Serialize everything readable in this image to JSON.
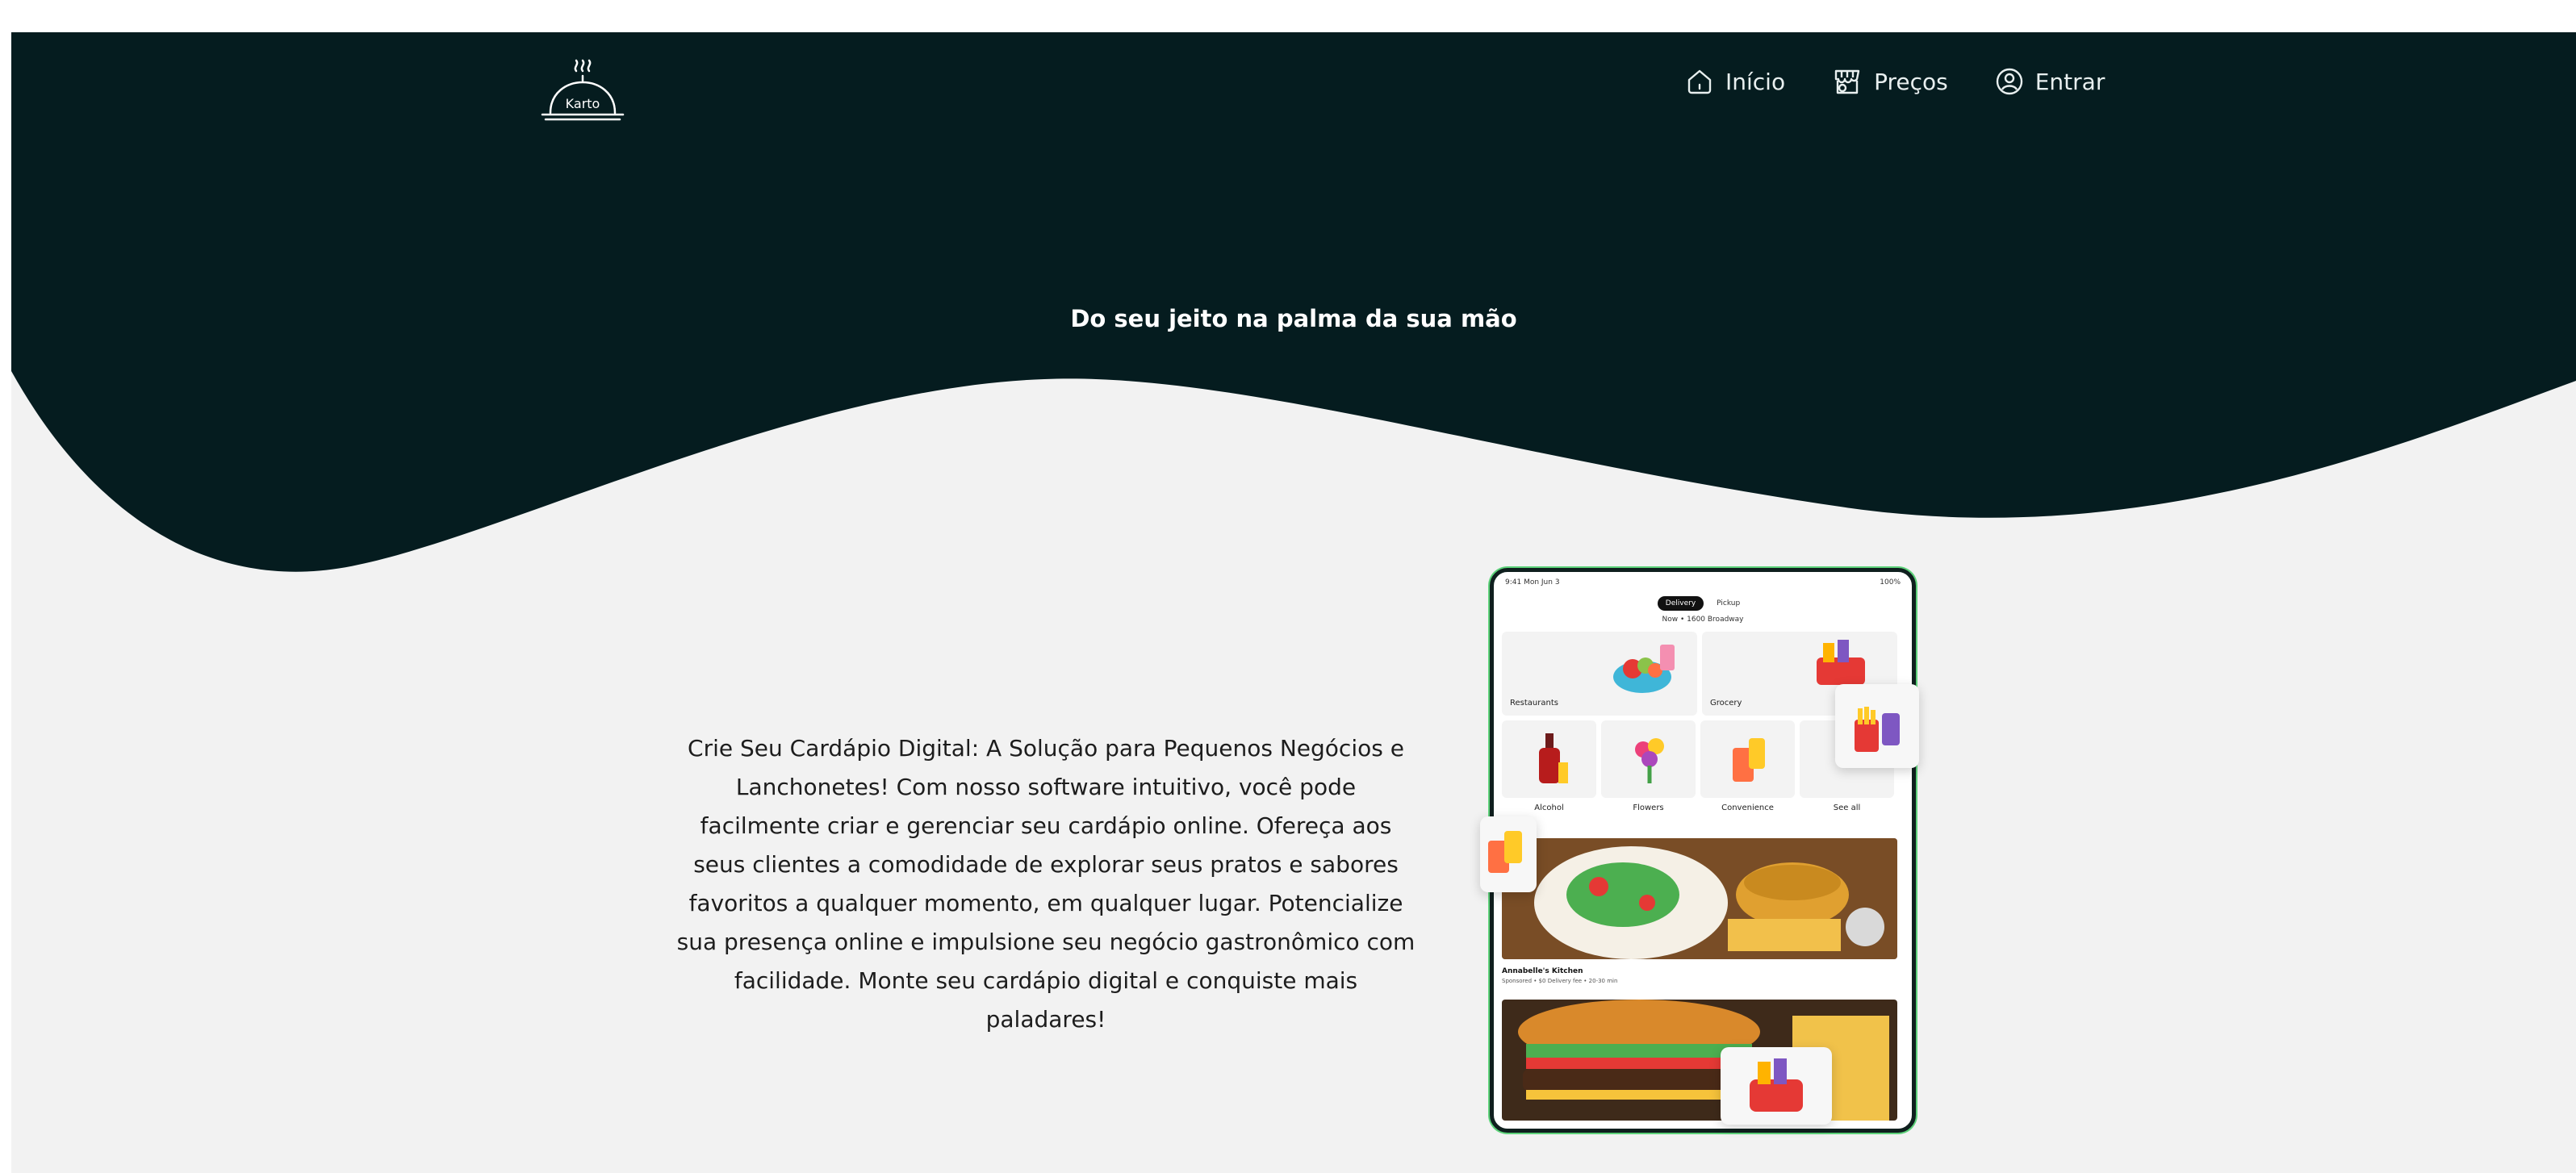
{
  "brand": {
    "logo_text": "Karto"
  },
  "nav": {
    "home_label": "Início",
    "pricing_label": "Preços",
    "login_label": "Entrar"
  },
  "hero": {
    "tagline": "Do seu jeito na palma da sua mão"
  },
  "description": "Crie Seu Cardápio Digital: A Solução para Pequenos Negócios e Lanchonetes! Com nosso software intuitivo, você pode facilmente criar e gerenciar seu cardápio online. Ofereça aos seus clientes a comodidade de explorar seus pratos e sabores favoritos a qualquer momento, em qualquer lugar. Potencialize sua presença online e impulsione seu negócio gastronômico com facilidade. Monte seu cardápio digital e conquiste mais paladares!",
  "mockup": {
    "status_time": "9:41 Mon Jun 3",
    "status_battery": "100%",
    "tab_delivery": "Delivery",
    "tab_pickup": "Pickup",
    "address": "Now • 1600 Broadway",
    "tile_restaurants": "Restaurants",
    "tile_grocery": "Grocery",
    "tile_alcohol": "Alcohol",
    "tile_flowers": "Flowers",
    "tile_convenience": "Convenience",
    "tile_see_all": "See all",
    "restaurant_name": "Annabelle's Kitchen",
    "restaurant_meta": "Sponsored • $0 Delivery fee • 20-30 min"
  },
  "colors": {
    "hero_bg": "#051c1f",
    "page_bg": "#f2f2f2",
    "phone_accent": "#5dd27a"
  },
  "icons": [
    "logo-cloche-icon",
    "home-icon",
    "store-icon",
    "user-circle-icon"
  ]
}
